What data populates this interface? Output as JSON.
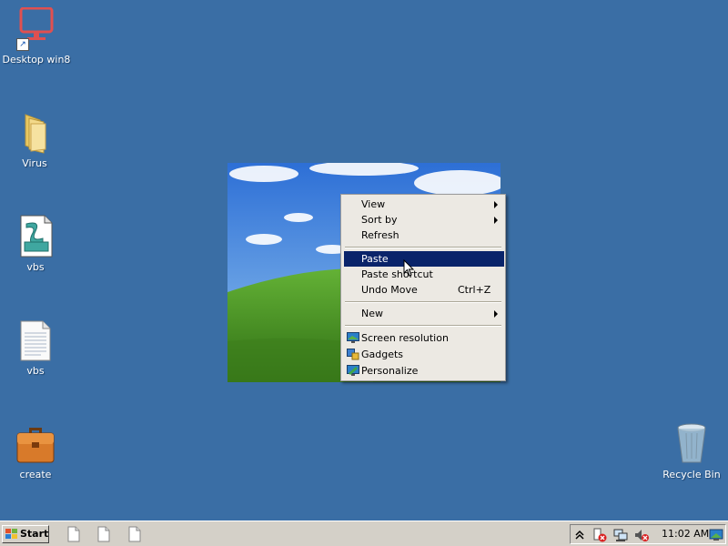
{
  "desktop": {
    "background_color": "#3a6ea5",
    "icons": [
      {
        "label": "Desktop win8",
        "icon": "monitor-shortcut-icon"
      },
      {
        "label": "Virus",
        "icon": "folder-icon"
      },
      {
        "label": "vbs",
        "icon": "script-file-icon"
      },
      {
        "label": "vbs",
        "icon": "text-file-icon"
      },
      {
        "label": "create",
        "icon": "briefcase-icon"
      },
      {
        "label": "Recycle Bin",
        "icon": "recycle-bin-icon"
      }
    ]
  },
  "wallpaper": {
    "name": "bliss-wallpaper"
  },
  "context_menu": {
    "items": [
      {
        "label": "View",
        "submenu": true
      },
      {
        "label": "Sort by",
        "submenu": true
      },
      {
        "label": "Refresh"
      },
      {
        "label": "Paste",
        "highlighted": true
      },
      {
        "label": "Paste shortcut"
      },
      {
        "label": "Undo Move",
        "shortcut": "Ctrl+Z"
      },
      {
        "label": "New",
        "submenu": true
      },
      {
        "label": "Screen resolution",
        "icon": "monitor-icon"
      },
      {
        "label": "Gadgets",
        "icon": "gadgets-icon"
      },
      {
        "label": "Personalize",
        "icon": "personalize-icon"
      }
    ],
    "highlight_color": "#0a246a"
  },
  "taskbar": {
    "start_label": "Start",
    "quick_launch": [
      "document-icon",
      "document-icon",
      "document-icon"
    ],
    "tray": {
      "icons": [
        "show-hidden-icons-chevron",
        "action-center-warning-icon",
        "network-icon",
        "volume-muted-icon",
        "show-desktop-icon"
      ],
      "clock": "11:02 AM"
    }
  }
}
